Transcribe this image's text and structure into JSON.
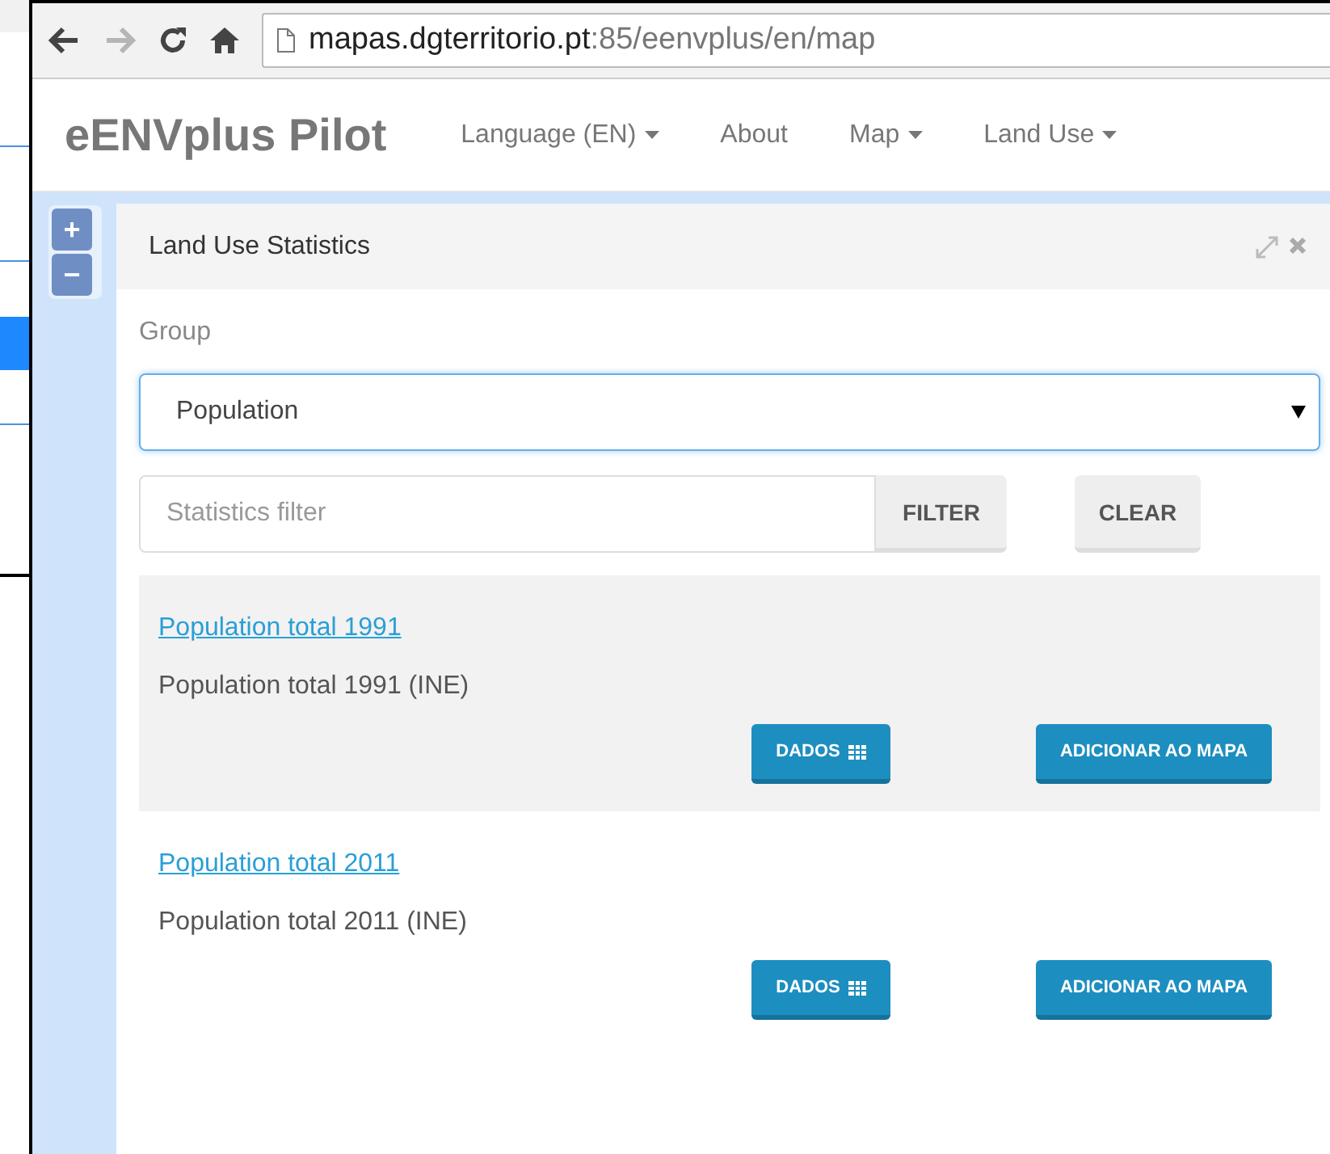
{
  "browser": {
    "url_host": "mapas.dgterritorio.pt",
    "url_path": ":85/eenvplus/en/map",
    "forward_disabled": true
  },
  "navbar": {
    "brand": "eENVplus Pilot",
    "items": [
      {
        "label": "Language (EN)",
        "dropdown": true
      },
      {
        "label": "About",
        "dropdown": false
      },
      {
        "label": "Map",
        "dropdown": true
      },
      {
        "label": "Land Use",
        "dropdown": true
      }
    ]
  },
  "zoom": {
    "in": "+",
    "out": "−"
  },
  "panel": {
    "title": "Land Use Statistics",
    "group_label": "Group",
    "group_value": "Population",
    "filter_placeholder": "Statistics filter",
    "filter_button": "FILTER",
    "clear_button": "CLEAR",
    "results": [
      {
        "title": "Population total 1991",
        "description": "Population total 1991 (INE)",
        "highlighted": true,
        "data_button": "DADOS",
        "add_button": "ADICIONAR AO MAPA"
      },
      {
        "title": "Population total 2011",
        "description": "Population total 2011 (INE)",
        "highlighted": false,
        "data_button": "DADOS",
        "add_button": "ADICIONAR AO MAPA"
      }
    ]
  }
}
